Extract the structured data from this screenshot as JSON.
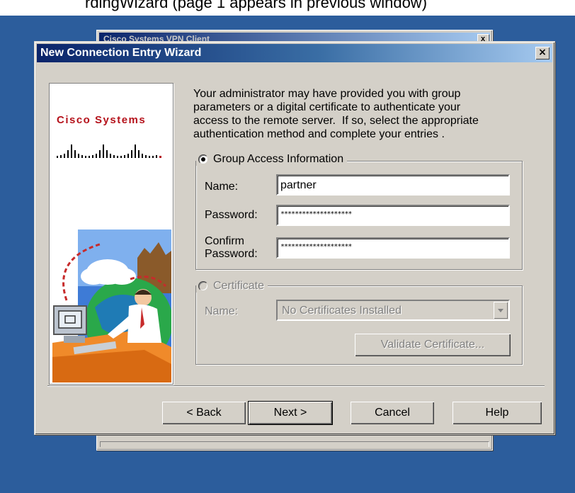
{
  "top_caption": "rdingWizard (page 1 appears in previous window)",
  "background_window": {
    "title": "Cisco Systems VPN Client",
    "close_label": "x"
  },
  "wizard": {
    "title": "New Connection Entry Wizard",
    "close_label": "×",
    "logo_text": "Cisco Systems",
    "intro_text": "Your administrator may have provided you with group\nparameters or a digital certificate to authenticate your\naccess to the remote server.  If so, select the appropriate\nauthentication method and complete your entries .",
    "group_access": {
      "label": "Group Access Information",
      "selected": true,
      "name_label": "Name:",
      "name_value": "partner",
      "password_label": "Password:",
      "password_value": "********************",
      "confirm_label": "Confirm\nPassword:",
      "confirm_value": "********************"
    },
    "certificate": {
      "label": "Certificate",
      "selected": false,
      "name_label": "Name:",
      "name_value": "No Certificates Installed",
      "validate_label": "Validate Certificate..."
    },
    "buttons": {
      "back": "< Back",
      "next": "Next >",
      "cancel": "Cancel",
      "help": "Help"
    }
  },
  "colors": {
    "desktop": "#2c5d9c",
    "titlebar_start": "#0a246a",
    "titlebar_end": "#a6caf0",
    "dialog_face": "#d4d0c8",
    "cisco_red": "#b5121b"
  }
}
